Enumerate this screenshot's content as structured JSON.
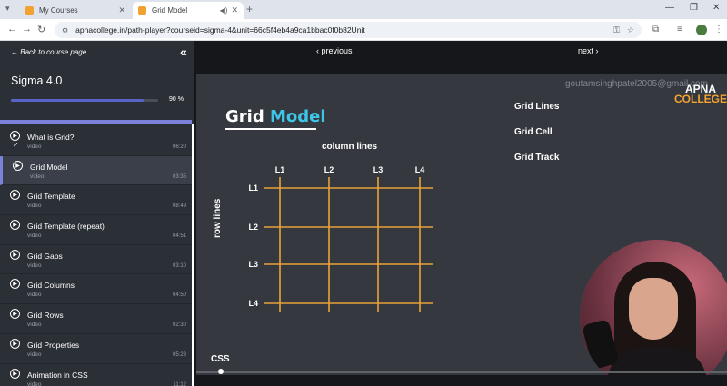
{
  "browser": {
    "tabs": [
      {
        "title": "My Courses",
        "active": false,
        "favicon_color": "#f2a230"
      },
      {
        "title": "Grid Model",
        "active": true,
        "favicon_color": "#f2a230"
      }
    ],
    "url": "apnacollege.in/path-player?courseid=sigma-4&unit=66c5f4eb4a9ca1bbac0f0b82Unit"
  },
  "sidebar": {
    "back_label": "Back to course page",
    "course_title": "Sigma 4.0",
    "progress_percent": 90,
    "progress_label": "90 %",
    "lessons": [
      {
        "title": "What is Grid?",
        "type": "video",
        "duration": "06:20",
        "completed": true,
        "active": false
      },
      {
        "title": "Grid Model",
        "type": "video",
        "duration": "03:35",
        "completed": false,
        "active": true
      },
      {
        "title": "Grid Template",
        "type": "video",
        "duration": "08:49",
        "completed": false,
        "active": false
      },
      {
        "title": "Grid Template (repeat)",
        "type": "video",
        "duration": "04:51",
        "completed": false,
        "active": false
      },
      {
        "title": "Grid Gaps",
        "type": "video",
        "duration": "03:10",
        "completed": false,
        "active": false
      },
      {
        "title": "Grid Columns",
        "type": "video",
        "duration": "04:50",
        "completed": false,
        "active": false
      },
      {
        "title": "Grid Rows",
        "type": "video",
        "duration": "02:30",
        "completed": false,
        "active": false
      },
      {
        "title": "Grid Properties",
        "type": "video",
        "duration": "05:23",
        "completed": false,
        "active": false
      },
      {
        "title": "Animation in CSS",
        "type": "video",
        "duration": "11:12",
        "completed": false,
        "active": false
      }
    ]
  },
  "player": {
    "previous_label": "‹ previous",
    "next_label": "next ›",
    "watermark": "goutamsinghpatel2005@gmail.com",
    "brand_line1": "APNA",
    "brand_line2": "COLLEGE",
    "slide_title_word1": "Grid",
    "slide_title_word2": "Model",
    "terms": [
      "Grid Lines",
      "Grid Cell",
      "Grid Track"
    ],
    "column_lines_label": "column lines",
    "row_lines_label": "row lines",
    "column_labels": [
      "L1",
      "L2",
      "L3",
      "L4"
    ],
    "row_labels": [
      "L1",
      "L2",
      "L3",
      "L4"
    ],
    "topic_label": "CSS",
    "grid_line_color": "#e8a33a"
  }
}
